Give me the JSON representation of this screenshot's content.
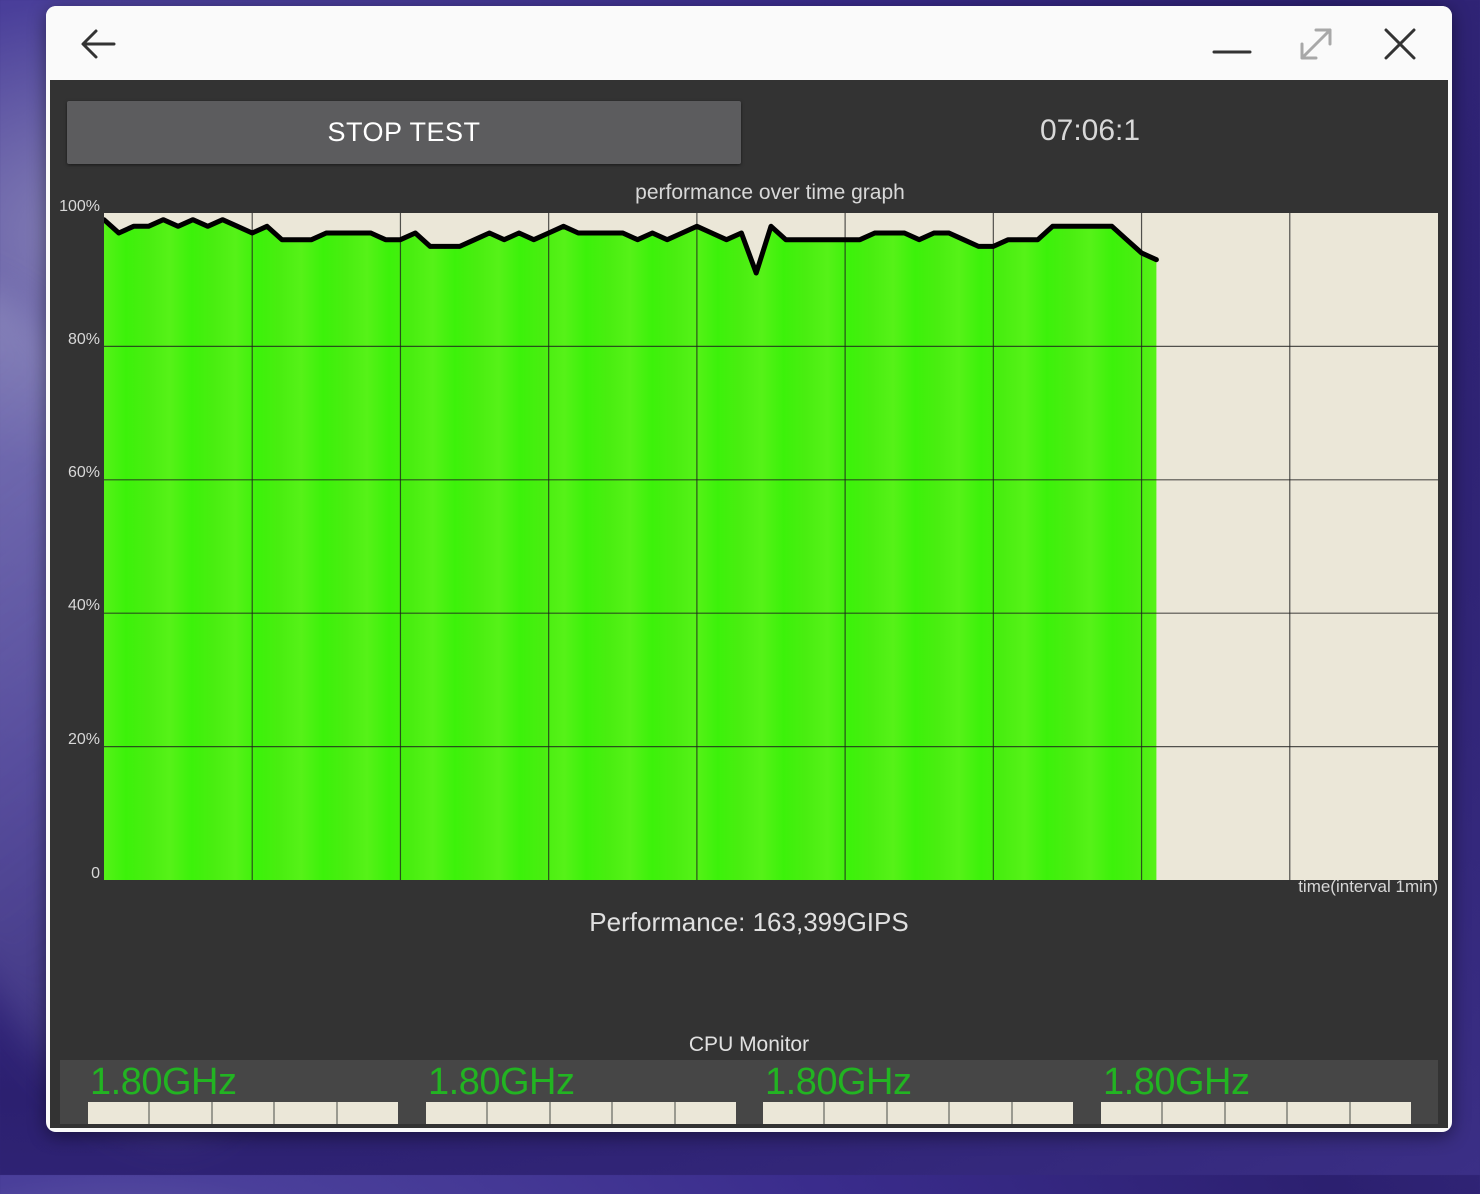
{
  "colors": {
    "app_bg": "#333333",
    "plot_bg": "#ebe7d8",
    "fill_green": "#3cf20a",
    "line": "#000000",
    "freq_text": "#22b422"
  },
  "titlebar": {
    "back_icon": "back-arrow-icon",
    "minimize_icon": "minimize-icon",
    "maximize_icon": "maximize-icon",
    "close_icon": "close-icon"
  },
  "controls": {
    "stop_label": "STOP TEST",
    "timer": "07:06:1"
  },
  "graph": {
    "title": "performance over time graph",
    "x_label": "time(interval 1min)"
  },
  "performance_text": "Performance: 163,399GIPS",
  "cpu_monitor": {
    "title": "CPU Monitor",
    "cores": [
      {
        "freq": "1.80GHz",
        "load_segments": 5
      },
      {
        "freq": "1.80GHz",
        "load_segments": 5
      },
      {
        "freq": "1.80GHz",
        "load_segments": 5
      },
      {
        "freq": "1.80GHz",
        "load_segments": 5
      }
    ]
  },
  "chart_data": {
    "type": "area",
    "ylabel": "",
    "xlabel": "time(interval 1min)",
    "ylim": [
      0,
      100
    ],
    "xlim": [
      0,
      9
    ],
    "y_ticks": [
      "0",
      "20%",
      "40%",
      "60%",
      "80%",
      "100%"
    ],
    "grid": true,
    "x": [
      0,
      0.1,
      0.2,
      0.3,
      0.4,
      0.5,
      0.6,
      0.7,
      0.8,
      0.9,
      1.0,
      1.1,
      1.2,
      1.3,
      1.4,
      1.5,
      1.6,
      1.7,
      1.8,
      1.9,
      2.0,
      2.1,
      2.2,
      2.3,
      2.4,
      2.5,
      2.6,
      2.7,
      2.8,
      2.9,
      3.0,
      3.1,
      3.2,
      3.3,
      3.4,
      3.5,
      3.6,
      3.7,
      3.8,
      3.9,
      4.0,
      4.1,
      4.2,
      4.3,
      4.4,
      4.5,
      4.6,
      4.7,
      4.8,
      4.9,
      5.0,
      5.1,
      5.2,
      5.3,
      5.4,
      5.5,
      5.6,
      5.7,
      5.8,
      5.9,
      6.0,
      6.1,
      6.2,
      6.3,
      6.4,
      6.5,
      6.6,
      6.7,
      6.8,
      6.9,
      7.0,
      7.1
    ],
    "values": [
      99,
      97,
      98,
      98,
      99,
      98,
      99,
      98,
      99,
      98,
      97,
      98,
      96,
      96,
      96,
      97,
      97,
      97,
      97,
      96,
      96,
      97,
      95,
      95,
      95,
      96,
      97,
      96,
      97,
      96,
      97,
      98,
      97,
      97,
      97,
      97,
      96,
      97,
      96,
      97,
      98,
      97,
      96,
      97,
      91,
      98,
      96,
      96,
      96,
      96,
      96,
      96,
      97,
      97,
      97,
      96,
      97,
      97,
      96,
      95,
      95,
      96,
      96,
      96,
      98,
      98,
      98,
      98,
      98,
      96,
      94,
      93
    ]
  }
}
